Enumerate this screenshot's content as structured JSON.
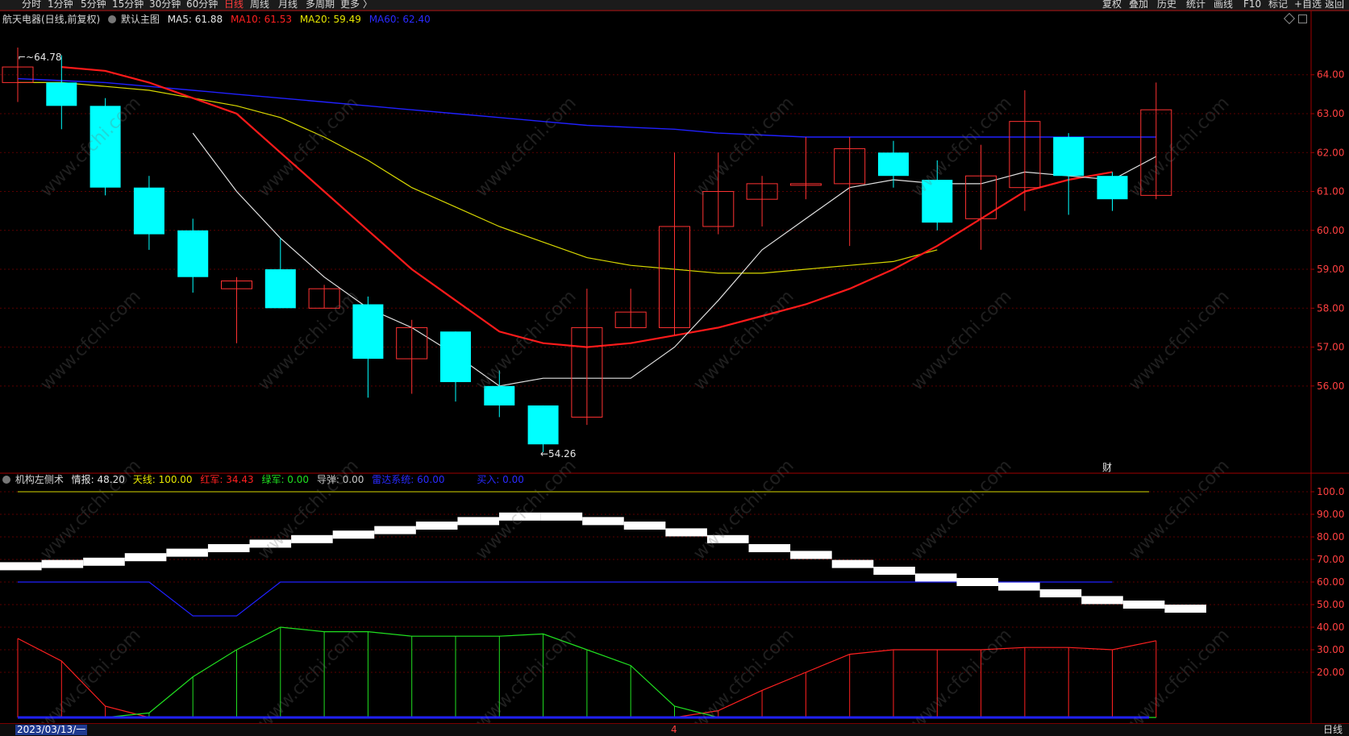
{
  "toolbar": {
    "left_tabs": [
      "分时",
      "1分钟",
      "5分钟",
      "15分钟",
      "30分钟",
      "60分钟",
      "日线",
      "周线",
      "月线",
      "多周期",
      "更多 〉"
    ],
    "active_tab": "日线",
    "right_tabs": [
      "复权",
      "叠加",
      "历史",
      "统计",
      "画线",
      "F10",
      "标记",
      "+自选",
      "返回"
    ]
  },
  "main_panel": {
    "title": "航天电器(日线,前复权)",
    "template_label": "默认主图",
    "ma": [
      {
        "label": "MA5: 61.88",
        "color": "#e6e6e6"
      },
      {
        "label": "MA10: 61.53",
        "color": "#ff2020"
      },
      {
        "label": "MA20: 59.49",
        "color": "#e6e600"
      },
      {
        "label": "MA60: 62.40",
        "color": "#2a2aff"
      }
    ],
    "high_marker": "64.78",
    "low_marker": "54.26",
    "cai_marker": "财",
    "price_ticks": [
      "64.00",
      "63.00",
      "62.00",
      "61.00",
      "60.00",
      "59.00",
      "58.00",
      "57.00",
      "56.00"
    ]
  },
  "indicator_panel": {
    "title": "机构左侧术",
    "items": [
      {
        "label": "情报: 48.20",
        "color": "#e6e6e6"
      },
      {
        "label": "天线: 100.00",
        "color": "#e6e600"
      },
      {
        "label": "红军: 34.43",
        "color": "#ff2020"
      },
      {
        "label": "绿军: 0.00",
        "color": "#20e020"
      },
      {
        "label": "导弹: 0.00",
        "color": "#c8c8c8"
      },
      {
        "label": "雷达系统: 60.00",
        "color": "#2a2aff"
      },
      {
        "label": "买入: 0.00",
        "color": "#2a2aff"
      }
    ],
    "ticks": [
      "100.0",
      "90.00",
      "80.00",
      "70.00",
      "60.00",
      "50.00",
      "40.00",
      "30.00",
      "20.00"
    ]
  },
  "bottom": {
    "date": "2023/03/13/一",
    "month_mark": "4",
    "period_label": "日线"
  },
  "watermark": "www.cfchi.com",
  "chart_data": {
    "type": "candlestick",
    "candles": [
      {
        "o": 63.8,
        "c": 64.2,
        "h": 64.7,
        "l": 63.3
      },
      {
        "o": 63.8,
        "c": 63.2,
        "h": 64.5,
        "l": 62.6
      },
      {
        "o": 63.2,
        "c": 61.1,
        "h": 63.4,
        "l": 60.9
      },
      {
        "o": 61.1,
        "c": 59.9,
        "h": 61.4,
        "l": 59.5
      },
      {
        "o": 60.0,
        "c": 58.8,
        "h": 60.3,
        "l": 58.4
      },
      {
        "o": 58.5,
        "c": 58.7,
        "h": 58.8,
        "l": 57.1
      },
      {
        "o": 59.0,
        "c": 58.0,
        "h": 59.8,
        "l": 58.0
      },
      {
        "o": 58.0,
        "c": 58.5,
        "h": 58.6,
        "l": 58.0
      },
      {
        "o": 58.1,
        "c": 56.7,
        "h": 58.3,
        "l": 55.7
      },
      {
        "o": 56.7,
        "c": 57.5,
        "h": 57.7,
        "l": 55.8
      },
      {
        "o": 57.4,
        "c": 56.1,
        "h": 57.4,
        "l": 55.6
      },
      {
        "o": 56.0,
        "c": 55.5,
        "h": 56.4,
        "l": 55.2
      },
      {
        "o": 55.5,
        "c": 54.5,
        "h": 55.5,
        "l": 54.3
      },
      {
        "o": 55.2,
        "c": 57.5,
        "h": 58.5,
        "l": 55.0
      },
      {
        "o": 57.5,
        "c": 57.9,
        "h": 58.5,
        "l": 57.5
      },
      {
        "o": 57.5,
        "c": 60.1,
        "h": 62.0,
        "l": 57.3
      },
      {
        "o": 60.1,
        "c": 61.0,
        "h": 62.0,
        "l": 59.9
      },
      {
        "o": 60.8,
        "c": 61.2,
        "h": 61.4,
        "l": 60.1
      },
      {
        "o": 61.2,
        "c": 61.2,
        "h": 62.4,
        "l": 60.8
      },
      {
        "o": 61.2,
        "c": 62.1,
        "h": 62.4,
        "l": 59.6
      },
      {
        "o": 62.0,
        "c": 61.4,
        "h": 62.3,
        "l": 61.1
      },
      {
        "o": 61.3,
        "c": 60.2,
        "h": 61.8,
        "l": 60.0
      },
      {
        "o": 60.3,
        "c": 61.4,
        "h": 62.2,
        "l": 59.5
      },
      {
        "o": 61.1,
        "c": 62.8,
        "h": 63.6,
        "l": 60.5
      },
      {
        "o": 62.4,
        "c": 61.4,
        "h": 62.5,
        "l": 60.4
      },
      {
        "o": 61.4,
        "c": 60.8,
        "h": 61.5,
        "l": 60.5
      },
      {
        "o": 60.9,
        "c": 63.1,
        "h": 63.8,
        "l": 60.8
      }
    ],
    "ma5": [
      null,
      null,
      null,
      null,
      62.5,
      61.0,
      59.8,
      58.8,
      58.0,
      57.5,
      56.8,
      56.0,
      56.2,
      56.2,
      56.2,
      57.0,
      58.2,
      59.5,
      60.3,
      61.1,
      61.3,
      61.2,
      61.2,
      61.5,
      61.4,
      61.3,
      61.9
    ],
    "ma10": [
      64.2,
      64.1,
      63.8,
      63.4,
      63.0,
      62.0,
      61.0,
      60.0,
      59.0,
      58.2,
      57.4,
      57.1,
      57.0,
      57.1,
      57.3,
      57.5,
      57.8,
      58.1,
      58.5,
      59.0,
      59.6,
      60.3,
      61.0,
      61.3,
      61.5
    ],
    "ma10_offset": 0,
    "ma20": [
      63.8,
      63.8,
      63.7,
      63.6,
      63.4,
      63.2,
      62.9,
      62.4,
      61.8,
      61.1,
      60.6,
      60.1,
      59.7,
      59.3,
      59.1,
      59.0,
      58.9,
      58.9,
      59.0,
      59.1,
      59.2,
      59.5
    ],
    "ma60": [
      63.9,
      63.85,
      63.8,
      63.7,
      63.6,
      63.5,
      63.4,
      63.3,
      63.2,
      63.1,
      63.0,
      62.9,
      62.8,
      62.7,
      62.65,
      62.6,
      62.5,
      62.45,
      62.4,
      62.4,
      62.4,
      62.4,
      62.4,
      62.4,
      62.4,
      62.4,
      62.4
    ],
    "price_range": [
      53.8,
      65.3
    ],
    "indicator": {
      "range": [
        0,
        100
      ],
      "tianxian": 100,
      "radar": [
        60,
        60,
        60,
        60,
        45,
        45,
        60,
        60,
        60,
        60,
        60,
        60,
        60,
        60,
        60,
        60,
        60,
        60,
        60,
        60,
        60,
        60,
        60,
        60,
        60,
        60
      ],
      "intel": [
        67,
        68,
        69,
        71,
        73,
        75,
        77,
        79,
        81,
        83,
        85,
        87,
        89,
        89,
        87,
        85,
        82,
        79,
        75,
        72,
        68,
        65,
        62,
        60,
        58,
        55,
        52,
        50,
        48.2
      ],
      "red": [
        35,
        25,
        5,
        0,
        0,
        0,
        0,
        0,
        0,
        0,
        0,
        0,
        0,
        0,
        0,
        0,
        3,
        12,
        20,
        28,
        30,
        30,
        30,
        31,
        31,
        30,
        34
      ],
      "green": [
        0,
        0,
        0,
        2,
        18,
        30,
        40,
        38,
        38,
        36,
        36,
        36,
        37,
        30,
        23,
        5,
        0,
        0,
        0,
        0,
        0,
        0,
        0,
        0,
        0,
        0,
        0
      ]
    }
  }
}
